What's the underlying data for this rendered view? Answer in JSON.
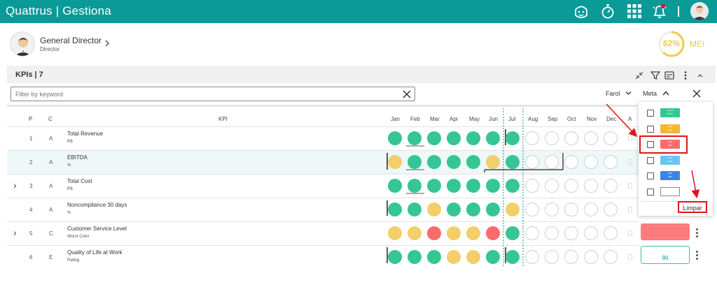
{
  "app": {
    "brand": "Quattrus | Gestiona"
  },
  "topbar": {
    "icons": [
      "support-face-icon",
      "stopwatch-icon",
      "apps-grid-icon",
      "bell-alert-icon",
      "user-avatar-icon"
    ]
  },
  "profile": {
    "name": "General Director",
    "role": "Director"
  },
  "progress": {
    "value": 0.62,
    "label": "62%",
    "mode": "MEI",
    "color": "#f1c94d"
  },
  "kpis": {
    "title": "KPIs | 7",
    "filter_placeholder": "Filter by keyword",
    "farol_label": "Farol",
    "meta_label": "Meta"
  },
  "columns": {
    "p": "P",
    "c": "C",
    "kpi": "KPI",
    "a": "A",
    "months": [
      "Jan",
      "Feb",
      "Mar",
      "Apr",
      "May",
      "Jun",
      "Jul",
      "Aug",
      "Sep",
      "Oct",
      "Nov",
      "Dec"
    ]
  },
  "rows": [
    {
      "p": "1",
      "c": "A",
      "name": "Total Revenue",
      "unit": "R$",
      "expand": false,
      "status": [
        "g",
        "g",
        "g",
        "g",
        "g",
        "g",
        "g",
        "e",
        "e",
        "e",
        "e",
        "e"
      ]
    },
    {
      "p": "2",
      "c": "A",
      "name": "EBITDA",
      "unit": "%",
      "expand": false,
      "highlight": true,
      "status": [
        "y",
        "g",
        "g",
        "g",
        "g",
        "y",
        "g",
        "e",
        "e",
        "e",
        "e",
        "e"
      ]
    },
    {
      "p": "3",
      "c": "A",
      "name": "Total Cost",
      "unit": "R$",
      "expand": true,
      "status": [
        "g",
        "g",
        "g",
        "g",
        "g",
        "g",
        "g",
        "e",
        "e",
        "e",
        "e",
        "e"
      ]
    },
    {
      "p": "4",
      "c": "A",
      "name": "Noncompliance 30 days",
      "unit": "%",
      "expand": false,
      "status": [
        "g",
        "g",
        "y",
        "g",
        "g",
        "g",
        "y",
        "e",
        "e",
        "e",
        "e",
        "e"
      ]
    },
    {
      "p": "5",
      "c": "C",
      "name": "Customer Service Level",
      "unit": "Worst Color",
      "expand": true,
      "status": [
        "y",
        "y",
        "r",
        "y",
        "y",
        "r",
        "g",
        "e",
        "e",
        "e",
        "e",
        "e"
      ]
    },
    {
      "p": "6",
      "c": "E",
      "name": "Quality of Life at Work",
      "unit": "Rating",
      "expand": false,
      "status": [
        "g",
        "g",
        "g",
        "y",
        "y",
        "g",
        "g",
        "e",
        "e",
        "e",
        "e",
        "e"
      ]
    }
  ],
  "meta_dropdown": {
    "options": [
      {
        "color": "#35c694",
        "line1": "110,00",
        "line2": "85,00"
      },
      {
        "color": "#f1b92f",
        "line1": "200",
        "line2": "150"
      },
      {
        "color": "#fb6b6b",
        "line1": "200",
        "line2": "180"
      },
      {
        "color": "#6cc4ee",
        "line1": "180",
        "line2": "300"
      },
      {
        "color": "#3a86e8",
        "line1": "180",
        "line2": "180"
      },
      {
        "color": "#ffffff",
        "line1": "",
        "line2": ""
      }
    ],
    "clear_label": "Limpar"
  },
  "right_values": {
    "row6_value": "90"
  },
  "colors": {
    "brand": "#0a9a98",
    "green": "#35c694",
    "yellow": "#f3cf6b",
    "red": "#fb6b6b",
    "annotation": "#e0131b"
  }
}
